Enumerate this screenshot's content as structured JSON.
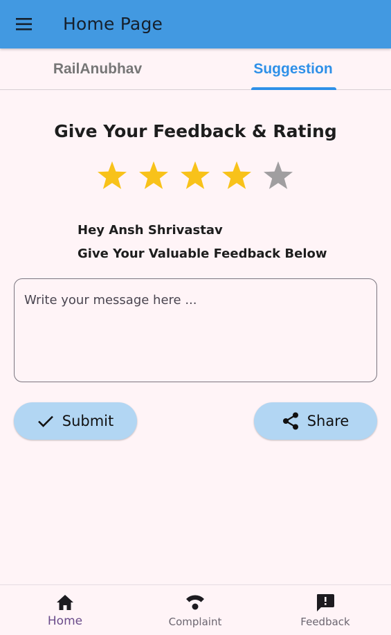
{
  "app_bar": {
    "title": "Home Page",
    "menu_icon": "hamburger-menu-icon",
    "background": "#4299e1"
  },
  "tabs": [
    {
      "label": "RailAnubhav",
      "selected": false
    },
    {
      "label": "Suggestion",
      "selected": true
    }
  ],
  "feedback": {
    "heading": "Give Your Feedback & Rating",
    "rating": 4,
    "max_rating": 5,
    "star_filled_color": "#f8c21a",
    "star_empty_color": "#a09ea0",
    "greeting": "Hey Ansh Shrivastav",
    "sub_greeting": "Give Your Valuable Feedback Below",
    "message_placeholder": "Write your message here ...",
    "message_value": ""
  },
  "buttons": {
    "submit_label": "Submit",
    "submit_icon": "check-icon",
    "share_label": "Share",
    "share_icon": "share-icon",
    "background": "#b2d6f3"
  },
  "bottom_nav": [
    {
      "label": "Home",
      "icon": "home-icon",
      "selected": true
    },
    {
      "label": "Complaint",
      "icon": "signal-icon",
      "selected": false
    },
    {
      "label": "Feedback",
      "icon": "feedback-icon",
      "selected": false
    }
  ]
}
